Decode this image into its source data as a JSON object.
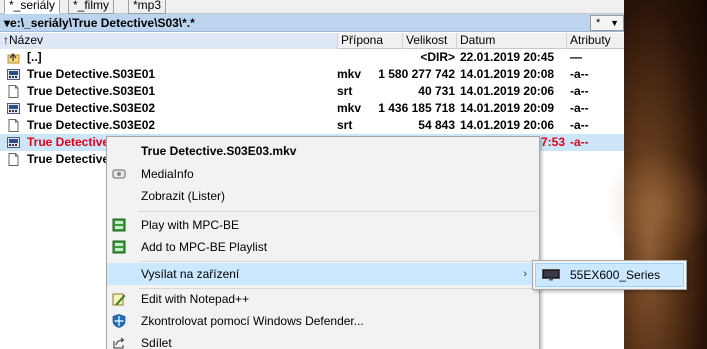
{
  "tabs": [
    {
      "label": "*_seriály",
      "active": true
    },
    {
      "label": "*_filmy",
      "active": false
    },
    {
      "label": "*mp3",
      "active": false
    }
  ],
  "path": {
    "text": "▾e:\\_seriály\\True Detective\\S03\\*.*",
    "filter": "*"
  },
  "columns": {
    "name": "↑Název",
    "ext": "Přípona",
    "size": "Velikost",
    "date": "Datum",
    "attr": "Atributy"
  },
  "files": [
    {
      "icon": "up-folder-icon",
      "name": "[..]",
      "ext": "",
      "size": "<DIR>",
      "date": "22.01.2019 20:45",
      "attr": "—"
    },
    {
      "icon": "video-file-icon",
      "name": "True Detective.S03E01",
      "ext": "mkv",
      "size": "1 580 277 742",
      "date": "14.01.2019 20:08",
      "attr": "-a--"
    },
    {
      "icon": "text-file-icon",
      "name": "True Detective.S03E01",
      "ext": "srt",
      "size": "40 731",
      "date": "14.01.2019 20:06",
      "attr": "-a--"
    },
    {
      "icon": "video-file-icon",
      "name": "True Detective.S03E02",
      "ext": "mkv",
      "size": "1 436 185 718",
      "date": "14.01.2019 20:09",
      "attr": "-a--"
    },
    {
      "icon": "text-file-icon",
      "name": "True Detective.S03E02",
      "ext": "srt",
      "size": "54 843",
      "date": "14.01.2019 20:06",
      "attr": "-a--"
    },
    {
      "icon": "video-file-icon",
      "name": "True Detective",
      "ext": "",
      "size": "",
      "date": "7:53",
      "attr": "-a--"
    },
    {
      "icon": "text-file-icon",
      "name": "True Detective",
      "ext": "",
      "size": "",
      "date": "",
      "attr": ""
    }
  ],
  "context_menu": {
    "title": "True Detective.S03E03.mkv",
    "items": [
      {
        "label": "MediaInfo",
        "icon": "mediainfo-icon"
      },
      {
        "label": "Zobrazit (Lister)",
        "icon": ""
      },
      {
        "label": "Play with MPC-BE",
        "icon": "mpc-be-icon"
      },
      {
        "label": "Add to MPC-BE Playlist",
        "icon": "mpc-be-playlist-icon"
      },
      {
        "label": "Vysílat na zařízení",
        "icon": "",
        "submenu": true
      },
      {
        "label": "Edit with Notepad++",
        "icon": "notepad-plus-icon"
      },
      {
        "label": "Zkontrolovat pomocí Windows Defender...",
        "icon": "windows-defender-icon"
      },
      {
        "label": "Sdílet",
        "icon": "share-icon"
      }
    ],
    "submenu_arrow": "›"
  },
  "submenu": {
    "item": "55EX600_Series",
    "icon": "tv-device-icon"
  },
  "colors": {
    "selection": "#cde6f7",
    "menu_hover": "#cce8ff",
    "pathbar": "#bcd4ee",
    "red_file": "#e0001a"
  }
}
